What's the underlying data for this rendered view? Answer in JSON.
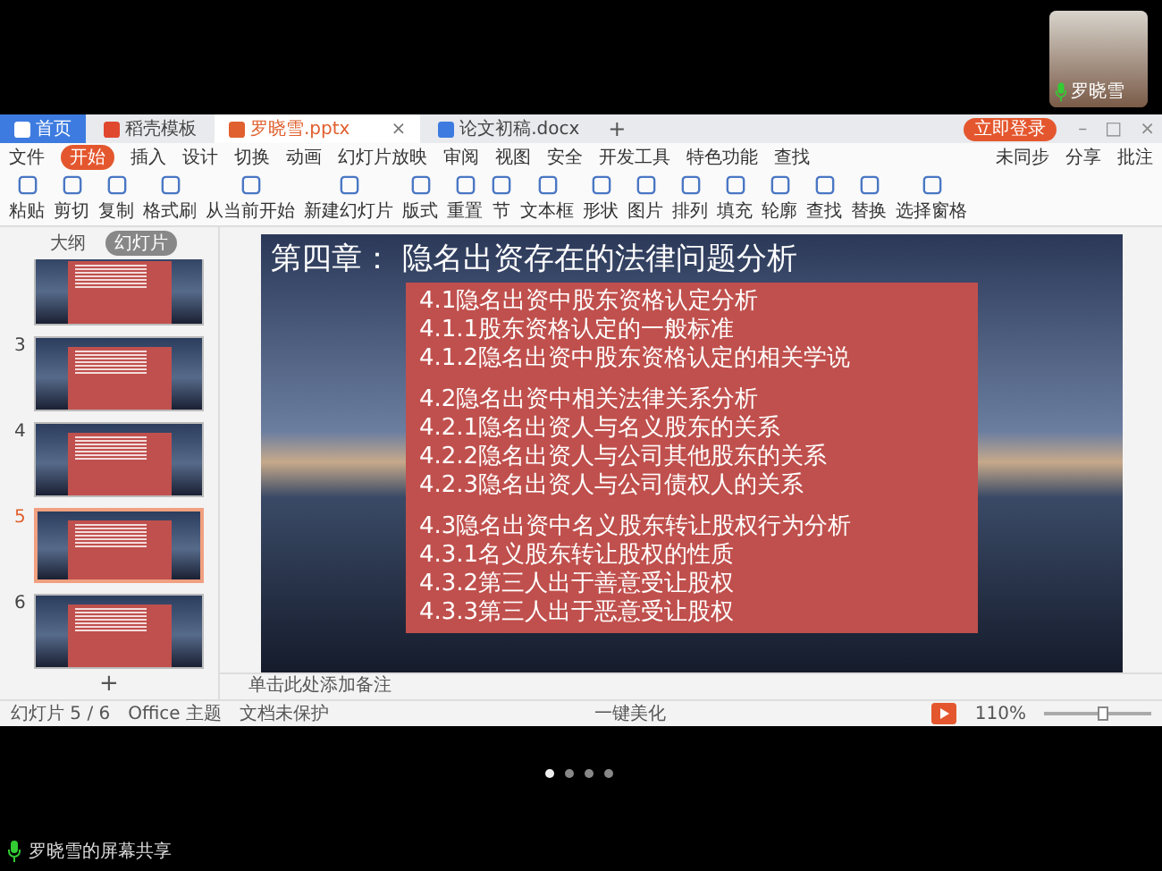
{
  "video": {
    "name": "罗晓雪"
  },
  "tabs": [
    {
      "label": "首页",
      "kind": "home",
      "selected": false
    },
    {
      "label": "稻壳模板",
      "kind": "doc",
      "selected": false
    },
    {
      "label": "罗晓雪.pptx",
      "kind": "ppt",
      "selected": true,
      "close": "×"
    },
    {
      "label": "论文初稿.docx",
      "kind": "word",
      "selected": false
    }
  ],
  "new_tab": "+",
  "login": "立即登录",
  "window_controls": [
    "–",
    "□",
    "×"
  ],
  "menu": {
    "file": "文件",
    "items": [
      {
        "label": "开始",
        "selected": true
      },
      {
        "label": "插入",
        "selected": false
      },
      {
        "label": "设计",
        "selected": false
      },
      {
        "label": "切换",
        "selected": false
      },
      {
        "label": "动画",
        "selected": false
      },
      {
        "label": "幻灯片放映",
        "selected": false
      },
      {
        "label": "审阅",
        "selected": false
      },
      {
        "label": "视图",
        "selected": false
      },
      {
        "label": "安全",
        "selected": false
      },
      {
        "label": "开发工具",
        "selected": false
      },
      {
        "label": "特色功能",
        "selected": false
      }
    ],
    "search": "查找",
    "right": [
      "未同步",
      "分享",
      "批注"
    ]
  },
  "tools": [
    "粘贴",
    "剪切",
    "复制",
    "格式刷",
    "从当前开始",
    "新建幻灯片",
    "版式",
    "重置",
    "节",
    "文本框",
    "形状",
    "图片",
    "排列",
    "填充",
    "轮廓",
    "查找",
    "替换",
    "选择窗格"
  ],
  "sidebar": {
    "tabs": [
      {
        "label": "大纲",
        "selected": false
      },
      {
        "label": "幻灯片",
        "selected": true
      }
    ],
    "thumbnails": [
      {
        "selected": false
      },
      {
        "number": "3",
        "selected": false
      },
      {
        "number": "4",
        "selected": false
      },
      {
        "number": "5",
        "selected": true
      },
      {
        "number": "6",
        "selected": false
      }
    ],
    "add": "+"
  },
  "slide": {
    "title": "第四章： 隐名出资存在的法律问题分析",
    "groups": [
      [
        "4.1隐名出资中股东资格认定分析",
        "4.1.1股东资格认定的一般标准",
        "4.1.2隐名出资中股东资格认定的相关学说"
      ],
      [
        "4.2隐名出资中相关法律关系分析",
        "4.2.1隐名出资人与名义股东的关系",
        "4.2.2隐名出资人与公司其他股东的关系",
        "4.2.3隐名出资人与公司债权人的关系"
      ],
      [
        "4.3隐名出资中名义股东转让股权行为分析",
        "4.3.1名义股东转让股权的性质",
        "4.3.2第三人出于善意受让股权",
        "4.3.3第三人出于恶意受让股权"
      ]
    ]
  },
  "notes": "单击此处添加备注",
  "status": {
    "slide": "幻灯片 5 / 6",
    "theme": "Office 主题",
    "protect": "文档未保护",
    "beautify": "一键美化",
    "zoom": "110%",
    "level": 0.55
  },
  "pager": [
    {
      "selected": true
    },
    {
      "selected": false
    },
    {
      "selected": false
    },
    {
      "selected": false
    }
  ],
  "share": "罗晓雪的屏幕共享"
}
